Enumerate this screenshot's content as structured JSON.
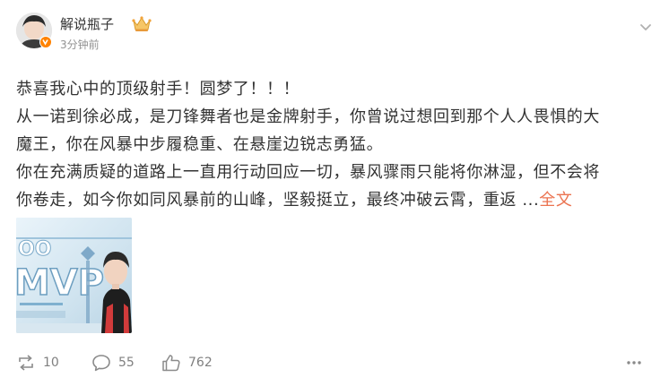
{
  "post": {
    "author": "解说瓶子",
    "timestamp": "3分钟前",
    "body_lines": [
      "恭喜我心中的顶级射手！圆梦了！！！",
      "从一诺到徐必成，是刀锋舞者也是金牌射手，你曾说过想回到那个人人畏惧的大",
      "魔王，你在风暴中步履稳重、在悬崖边锐志勇猛。",
      "你在充满质疑的道路上一直用行动回应一切，暴风骤雨只能将你淋湿，但不会将",
      "你卷走，如今你如同风暴前的山峰，坚毅挺立，最终冲破云霄，重返 ..."
    ],
    "expand_label": "全文",
    "image": {
      "overlay_text": "MVP",
      "overlay_digits": "OO"
    }
  },
  "actions": {
    "repost_count": "10",
    "comment_count": "55",
    "like_count": "762"
  },
  "colors": {
    "link": "#eb7350",
    "muted": "#939393",
    "badge": "#ff8200"
  },
  "icons": {
    "verified": "verified-badge-icon",
    "crown": "crown-icon",
    "more": "more-icon",
    "repost": "repost-icon",
    "comment": "comment-icon",
    "like": "like-icon"
  }
}
